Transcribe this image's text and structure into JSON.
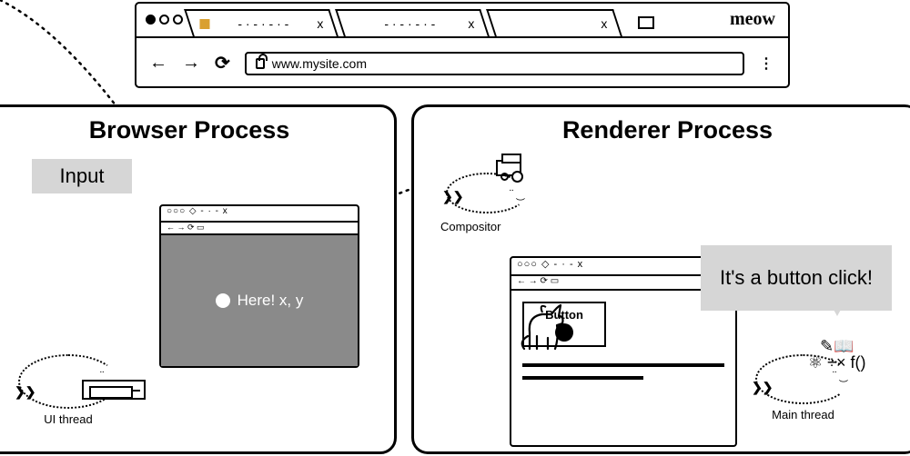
{
  "browser": {
    "url": "www.mysite.com",
    "brand": "meow",
    "tab1_placeholder": "- · - · - · -",
    "tab2_placeholder": "- · - · - · -",
    "tab_close": "x",
    "menu_glyph": "⋮",
    "nav": {
      "back": "←",
      "forward": "→",
      "reload": "⟳"
    }
  },
  "panes": {
    "left_title": "Browser Process",
    "right_title": "Renderer Process"
  },
  "labels": {
    "input": "Input",
    "compositor": "Compositor",
    "ui_thread": "UI thread",
    "main_thread": "Main thread"
  },
  "hit": {
    "text": "Here! x, y"
  },
  "page": {
    "button_label": "Button"
  },
  "callout": {
    "text": "It's a button click!"
  },
  "icons": {
    "mini_bar": "○○○  ◇ - · -  x",
    "mini_addr": "← → ⟳  ▭",
    "main_tools": "✎📖\n⚛ ÷× f()"
  }
}
